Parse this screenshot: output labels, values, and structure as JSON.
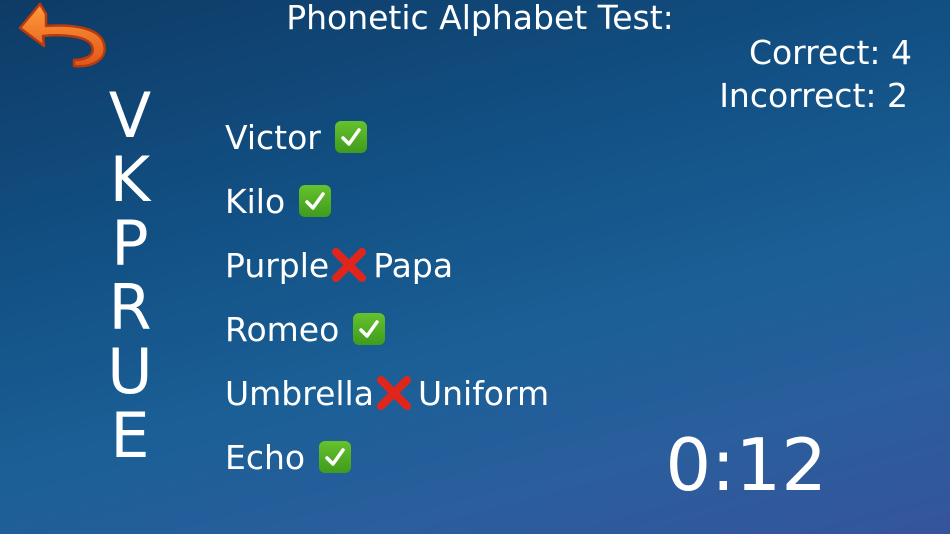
{
  "header": {
    "title": "Phonetic Alphabet Test:",
    "back_icon": "curved-back-arrow-icon",
    "back_color": "#f07a1c"
  },
  "score": {
    "correct_text": "Correct: 4",
    "incorrect_text": "Incorrect: 2"
  },
  "letters": [
    "V",
    "K",
    "P",
    "R",
    "U",
    "E"
  ],
  "answers": [
    {
      "word": "Victor",
      "status": "correct",
      "correction": ""
    },
    {
      "word": "Kilo",
      "status": "correct",
      "correction": ""
    },
    {
      "word": "Purple",
      "status": "incorrect",
      "correction": " Papa"
    },
    {
      "word": "Romeo",
      "status": "correct",
      "correction": ""
    },
    {
      "word": "Umbrella",
      "status": "incorrect",
      "correction": " Uniform"
    },
    {
      "word": "Echo",
      "status": "correct",
      "correction": ""
    }
  ],
  "timer": {
    "value": "0:12"
  },
  "colors": {
    "check_green": "#4caf25",
    "cross_red": "#e0261c"
  }
}
